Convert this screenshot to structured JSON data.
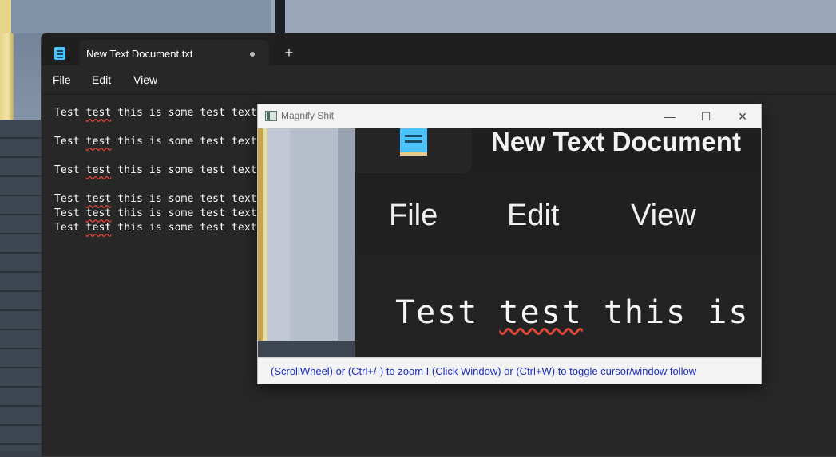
{
  "notepad": {
    "tab_title": "New Text Document.txt",
    "new_tab_symbol": "+",
    "menu": [
      "File",
      "Edit",
      "View"
    ],
    "lines": [
      {
        "pre": "Test ",
        "err": "test",
        "post": " this is some test text"
      },
      {
        "pre": "Test ",
        "err": "test",
        "post": " this is some test text"
      },
      {
        "pre": "Test ",
        "err": "test",
        "post": " this is some test text"
      },
      {
        "pre": "Test ",
        "err": "test",
        "post": " this is some test text"
      },
      {
        "pre": "Test ",
        "err": "test",
        "post": " this is some test text"
      },
      {
        "pre": "Test ",
        "err": "test",
        "post": " this is some test text"
      }
    ]
  },
  "magnifier": {
    "title": "Magnify Shit",
    "controls": {
      "minimize": "—",
      "maximize": "☐",
      "close": "✕"
    },
    "zoomed": {
      "title": "New Text Document",
      "menu": [
        "File",
        "Edit",
        "View"
      ],
      "line_pre": "Test ",
      "line_err": "test",
      "line_post": " this is s"
    },
    "help_text": "(ScrollWheel) or (Ctrl+/-) to zoom  I  (Click Window) or (Ctrl+W) to toggle cursor/window follow"
  },
  "colors": {
    "editor_bg": "#272727",
    "spell_error": "#e0463a",
    "help_text": "#1a2fbf",
    "accent": "#4cc2ff"
  }
}
